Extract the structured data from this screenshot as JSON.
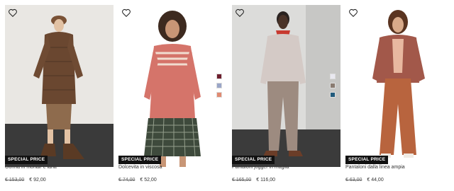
{
  "products": [
    {
      "name": "Gonna in mohair e lana",
      "old_price": "€ 153,00",
      "new_price": "€ 92,00",
      "badge": "SPECIAL PRICE",
      "swatches": []
    },
    {
      "name": "Dolcevita in viscosa",
      "old_price": "€ 74,00",
      "new_price": "€ 52,00",
      "badge": "SPECIAL PRICE",
      "swatches": [
        "#6e1f2e",
        "#9aa6c8",
        "#e08a72"
      ]
    },
    {
      "name": "Pantaloni jogger in maglia",
      "old_price": "€ 165,00",
      "new_price": "€ 116,00",
      "badge": "SPECIAL PRICE",
      "swatches": [
        "#e9e8f0",
        "#8a7c72",
        "#225b7c"
      ]
    },
    {
      "name": "Pantaloni dalla linea ampia",
      "old_price": "€ 63,00",
      "new_price": "€ 44,00",
      "badge": "SPECIAL PRICE",
      "swatches": []
    }
  ],
  "icons": {
    "wishlist": "heart-outline-icon"
  },
  "colors": {
    "badge_bg": "#111111",
    "badge_text": "#ffffff"
  }
}
